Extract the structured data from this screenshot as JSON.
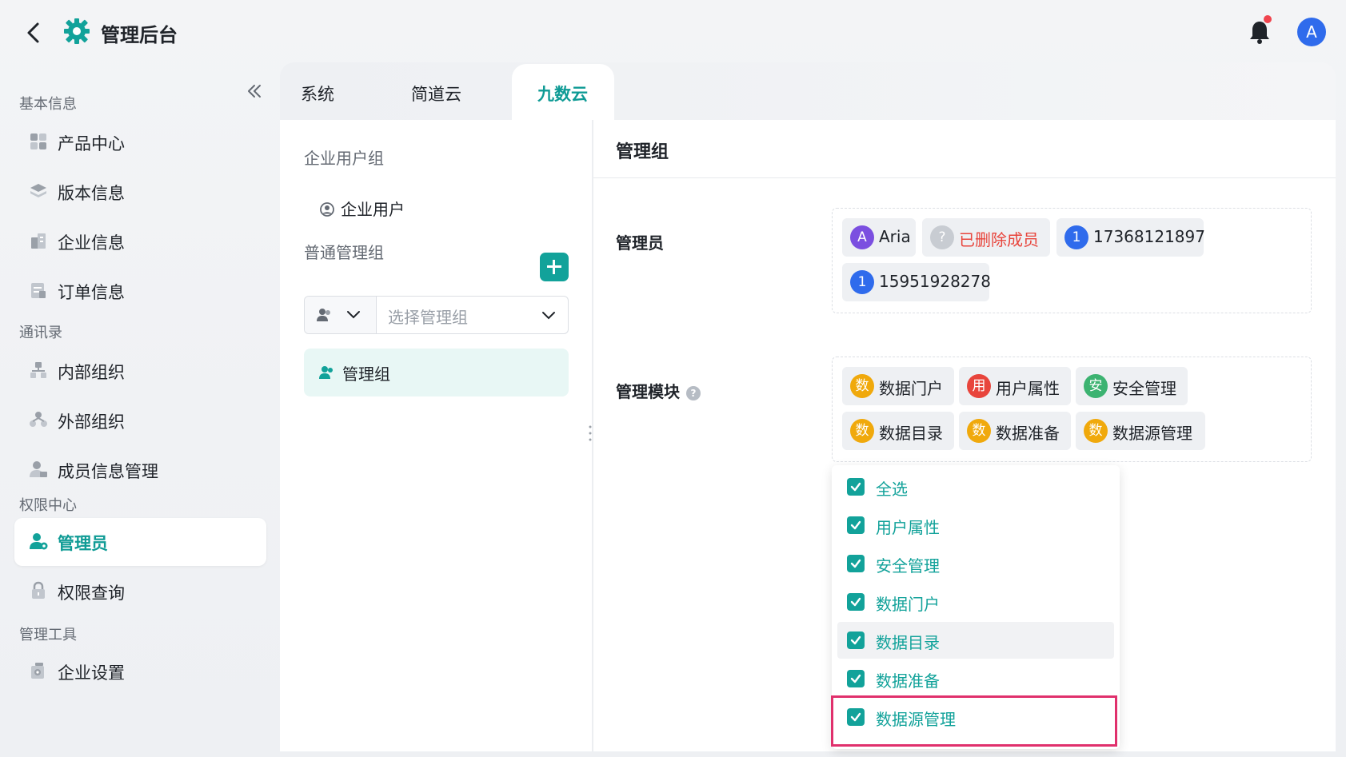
{
  "header": {
    "title": "管理后台",
    "avatar_letter": "A"
  },
  "sidebar": {
    "sections": [
      {
        "title": "基本信息"
      },
      {
        "title": "通讯录"
      },
      {
        "title": "权限中心"
      },
      {
        "title": "管理工具"
      }
    ],
    "items": [
      {
        "label": "产品中心",
        "icon": "grid-icon"
      },
      {
        "label": "版本信息",
        "icon": "layers-icon"
      },
      {
        "label": "企业信息",
        "icon": "building-icon"
      },
      {
        "label": "订单信息",
        "icon": "document-icon"
      },
      {
        "label": "内部组织",
        "icon": "org-tree-icon"
      },
      {
        "label": "外部组织",
        "icon": "external-org-icon"
      },
      {
        "label": "成员信息管理",
        "icon": "member-icon"
      },
      {
        "label": "管理员",
        "icon": "admin-icon",
        "active": true
      },
      {
        "label": "权限查询",
        "icon": "lock-icon"
      },
      {
        "label": "企业设置",
        "icon": "settings-icon"
      }
    ]
  },
  "tabs": [
    {
      "label": "系统"
    },
    {
      "label": "简道云"
    },
    {
      "label": "九数云",
      "active": true
    }
  ],
  "left_panel": {
    "enterprise_group_title": "企业用户组",
    "enterprise_user": "企业用户",
    "normal_group_title": "普通管理组",
    "select_placeholder": "选择管理组",
    "group_item": "管理组"
  },
  "right_panel": {
    "title": "管理组",
    "admins_label": "管理员",
    "admins": [
      {
        "avatar": "A",
        "name": "Aria",
        "color": "#7b4fe0"
      },
      {
        "avatar": "?",
        "name": "已删除成员",
        "color": "#b6bcc4",
        "deleted": true
      },
      {
        "avatar": "1",
        "name": "17368121897",
        "color": "#2f6bec"
      },
      {
        "avatar": "1",
        "name": "15951928278",
        "color": "#2f6bec"
      }
    ],
    "modules_label": "管理模块",
    "help_icon": "?",
    "modules": [
      {
        "badge": "数",
        "name": "数据门户",
        "color": "#f0a90c"
      },
      {
        "badge": "用",
        "name": "用户属性",
        "color": "#e8453c"
      },
      {
        "badge": "安",
        "name": "安全管理",
        "color": "#3cb371"
      },
      {
        "badge": "数",
        "name": "数据目录",
        "color": "#f0a90c"
      },
      {
        "badge": "数",
        "name": "数据准备",
        "color": "#f0a90c"
      },
      {
        "badge": "数",
        "name": "数据源管理",
        "color": "#f0a90c"
      }
    ]
  },
  "dropdown": {
    "options": [
      {
        "label": "全选",
        "checked": true
      },
      {
        "label": "用户属性",
        "checked": true
      },
      {
        "label": "安全管理",
        "checked": true
      },
      {
        "label": "数据门户",
        "checked": true
      },
      {
        "label": "数据目录",
        "checked": true
      },
      {
        "label": "数据准备",
        "checked": true
      },
      {
        "label": "数据源管理",
        "checked": true
      }
    ]
  },
  "colors": {
    "accent": "#12a29a",
    "highlight": "#e0306c"
  }
}
